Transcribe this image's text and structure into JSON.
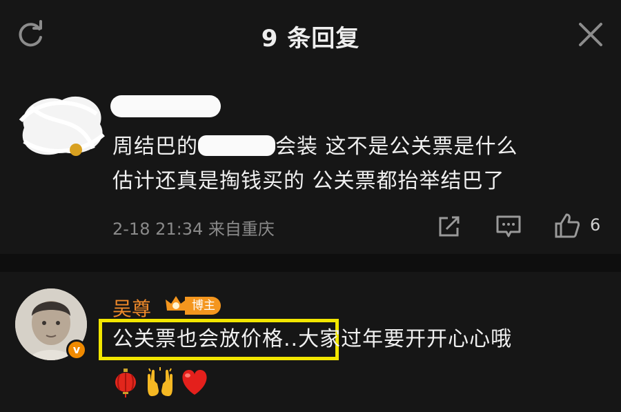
{
  "header": {
    "title": "9 条回复",
    "refresh_icon": "refresh-icon",
    "close_icon": "close-icon"
  },
  "comment1": {
    "text_part1": "周结巴的",
    "text_part2": "会装 这不是公关票是什么",
    "text_line2": "估计还真是掏钱买的 公关票都抬举结巴了",
    "time": "2-18 21:34",
    "location": "来自重庆",
    "like_count": "6",
    "icons": [
      "share-icon",
      "comment-icon",
      "like-icon"
    ]
  },
  "comment2": {
    "username": "吴尊",
    "badge": "博主",
    "verified_mark": "v",
    "text_highlighted": "公关票也会放价格..",
    "text_rest": "大家过年要开开心心哦",
    "emojis": [
      "lantern-emoji",
      "raised-hands-emoji",
      "red-heart-emoji"
    ],
    "colors": {
      "username": "#f08a2a",
      "highlight_box": "#f2e600",
      "badge": "#f4961e"
    }
  }
}
